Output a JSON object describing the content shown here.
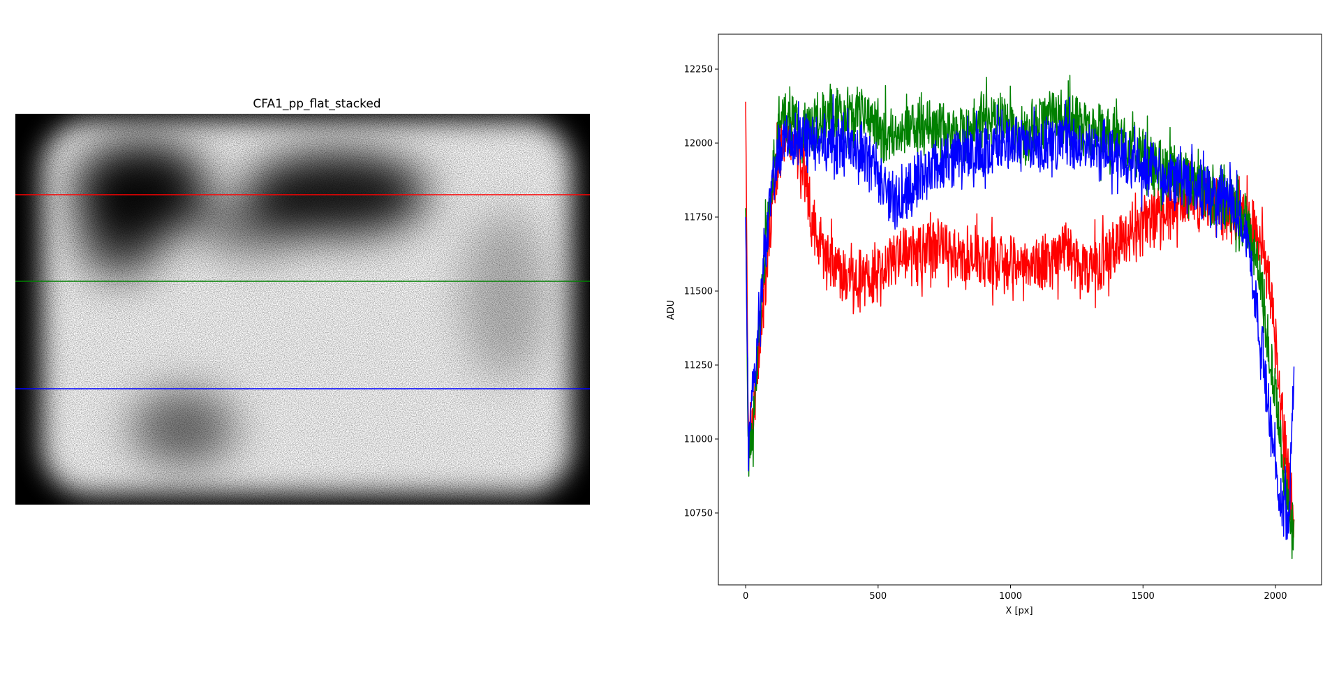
{
  "image_panel": {
    "title": "CFA1_pp_flat_stacked",
    "row_lines": [
      {
        "name": "red",
        "color": "#ff0000",
        "row_fraction": 0.25
      },
      {
        "name": "green",
        "color": "#008000",
        "row_fraction": 0.5
      },
      {
        "name": "blue",
        "color": "#0000ff",
        "row_fraction": 0.75
      }
    ]
  },
  "chart_data": {
    "type": "line",
    "title": "",
    "xlabel": "X [px]",
    "ylabel": "ADU",
    "xlim": [
      -103,
      2174
    ],
    "ylim": [
      10507,
      12368
    ],
    "xticks": [
      0,
      500,
      1000,
      1500,
      2000
    ],
    "yticks": [
      10750,
      11000,
      11250,
      11500,
      11750,
      12000,
      12250
    ],
    "grid": false,
    "legend": "none",
    "noise_amplitude": 110,
    "x": [
      0,
      10,
      25,
      50,
      75,
      100,
      125,
      150,
      200,
      250,
      300,
      350,
      400,
      450,
      500,
      550,
      600,
      650,
      700,
      750,
      800,
      850,
      900,
      950,
      1000,
      1050,
      1100,
      1150,
      1200,
      1250,
      1300,
      1350,
      1400,
      1450,
      1500,
      1550,
      1600,
      1650,
      1700,
      1750,
      1800,
      1850,
      1900,
      1950,
      1975,
      2000,
      2025,
      2050,
      2070
    ],
    "series": [
      {
        "name": "red row",
        "color": "#ff0000",
        "values": [
          12140,
          11000,
          11050,
          11300,
          11550,
          11800,
          11950,
          12050,
          11950,
          11750,
          11600,
          11580,
          11520,
          11550,
          11560,
          11600,
          11650,
          11620,
          11650,
          11640,
          11620,
          11600,
          11610,
          11590,
          11600,
          11600,
          11580,
          11600,
          11650,
          11600,
          11580,
          11600,
          11650,
          11700,
          11720,
          11750,
          11780,
          11800,
          11800,
          11790,
          11770,
          11760,
          11750,
          11650,
          11550,
          11350,
          11100,
          10850,
          10700
        ]
      },
      {
        "name": "green row",
        "color": "#008000",
        "values": [
          11780,
          10950,
          11000,
          11350,
          11650,
          11900,
          12030,
          12080,
          12050,
          12060,
          12080,
          12100,
          12080,
          12100,
          12050,
          12020,
          12050,
          12060,
          12040,
          12050,
          12030,
          12050,
          12080,
          12080,
          12050,
          12030,
          12060,
          12080,
          12100,
          12060,
          12050,
          12030,
          12020,
          12000,
          11950,
          11920,
          11900,
          11880,
          11850,
          11820,
          11800,
          11780,
          11720,
          11500,
          11300,
          11150,
          10950,
          10750,
          10650
        ]
      },
      {
        "name": "blue row",
        "color": "#0000ff",
        "values": [
          11750,
          10980,
          11150,
          11400,
          11650,
          11850,
          11980,
          12000,
          12010,
          12020,
          12000,
          11990,
          11980,
          11970,
          11900,
          11800,
          11820,
          11880,
          11920,
          11940,
          11950,
          11960,
          11980,
          12000,
          12000,
          12010,
          12000,
          11990,
          12000,
          11990,
          11980,
          11970,
          11960,
          11950,
          11930,
          11900,
          11880,
          11860,
          11850,
          11830,
          11810,
          11800,
          11650,
          11300,
          11100,
          10900,
          10780,
          10750,
          11250
        ]
      }
    ]
  }
}
